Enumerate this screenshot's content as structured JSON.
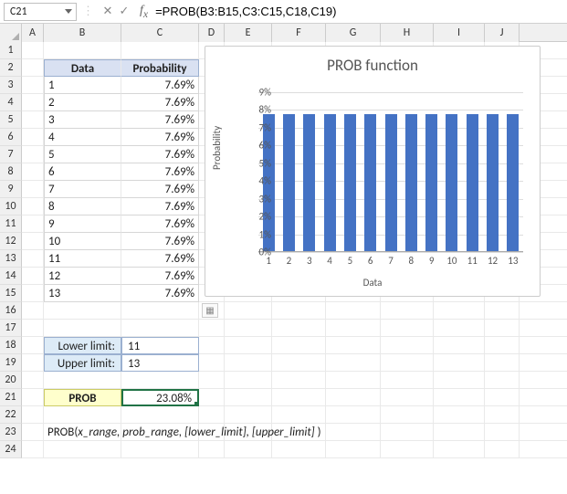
{
  "namebox_value": "C21",
  "formula": "=PROB(B3:B15,C3:C15,C18,C19)",
  "columns": [
    "A",
    "B",
    "C",
    "D",
    "E",
    "F",
    "G",
    "H",
    "I",
    "J"
  ],
  "row_count": 24,
  "table": {
    "header_data": "Data",
    "header_prob": "Probability",
    "rows": [
      {
        "data": "1",
        "prob": "7.69%"
      },
      {
        "data": "2",
        "prob": "7.69%"
      },
      {
        "data": "3",
        "prob": "7.69%"
      },
      {
        "data": "4",
        "prob": "7.69%"
      },
      {
        "data": "5",
        "prob": "7.69%"
      },
      {
        "data": "6",
        "prob": "7.69%"
      },
      {
        "data": "7",
        "prob": "7.69%"
      },
      {
        "data": "8",
        "prob": "7.69%"
      },
      {
        "data": "9",
        "prob": "7.69%"
      },
      {
        "data": "10",
        "prob": "7.69%"
      },
      {
        "data": "11",
        "prob": "7.69%"
      },
      {
        "data": "12",
        "prob": "7.69%"
      },
      {
        "data": "13",
        "prob": "7.69%"
      }
    ]
  },
  "limits": {
    "lower_label": "Lower limit:",
    "lower_value": "11",
    "upper_label": "Upper limit:",
    "upper_value": "13"
  },
  "result": {
    "label": "PROB",
    "value": "23.08%"
  },
  "syntax_prefix": "PROB(",
  "syntax_args": "x_range, prob_range, [lower_limit], [upper_limit]",
  "syntax_suffix": " )",
  "chart_data": {
    "type": "bar",
    "title": "PROB function",
    "xlabel": "Data",
    "ylabel": "Probability",
    "categories": [
      "1",
      "2",
      "3",
      "4",
      "5",
      "6",
      "7",
      "8",
      "9",
      "10",
      "11",
      "12",
      "13"
    ],
    "values": [
      7.69,
      7.69,
      7.69,
      7.69,
      7.69,
      7.69,
      7.69,
      7.69,
      7.69,
      7.69,
      7.69,
      7.69,
      7.69
    ],
    "y_ticks": [
      "0%",
      "1%",
      "2%",
      "3%",
      "4%",
      "5%",
      "6%",
      "7%",
      "8%",
      "9%"
    ],
    "ylim": [
      0,
      9
    ]
  }
}
